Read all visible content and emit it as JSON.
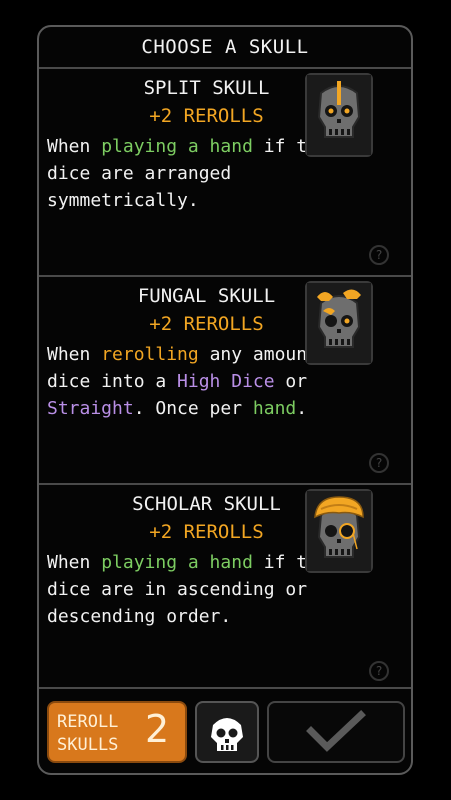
{
  "header": {
    "title": "CHOOSE A SKULL"
  },
  "cards": [
    {
      "title": "SPLIT SKULL",
      "reward": "+2 REROLLS",
      "desc": [
        {
          "t": "When ",
          "c": ""
        },
        {
          "t": "playing a hand",
          "c": "green"
        },
        {
          "t": " if the dice are arranged symmetrically.",
          "c": ""
        }
      ],
      "icon": "split-skull-icon"
    },
    {
      "title": "FUNGAL SKULL",
      "reward": "+2 REROLLS",
      "desc": [
        {
          "t": "When ",
          "c": ""
        },
        {
          "t": "rerolling",
          "c": "orange"
        },
        {
          "t": " any amount of dice into a ",
          "c": ""
        },
        {
          "t": "High Dice",
          "c": "purple"
        },
        {
          "t": " or ",
          "c": ""
        },
        {
          "t": "Straight",
          "c": "purple"
        },
        {
          "t": ". Once per ",
          "c": ""
        },
        {
          "t": "hand",
          "c": "green"
        },
        {
          "t": ".",
          "c": ""
        }
      ],
      "icon": "fungal-skull-icon"
    },
    {
      "title": "SCHOLAR SKULL",
      "reward": "+2 REROLLS",
      "desc": [
        {
          "t": "When ",
          "c": ""
        },
        {
          "t": "playing a hand",
          "c": "green"
        },
        {
          "t": " if the dice are in ascending or descending order.",
          "c": ""
        }
      ],
      "icon": "scholar-skull-icon"
    }
  ],
  "footer": {
    "reroll_label": "REROLL SKULLS",
    "reroll_count": "2",
    "skull_icon": "skull-icon",
    "confirm_icon": "checkmark-icon"
  },
  "colors": {
    "accent_orange": "#f2a623",
    "keyword_green": "#7dcd62",
    "keyword_purple": "#b98fe6",
    "reroll_button": "#d8781c"
  }
}
